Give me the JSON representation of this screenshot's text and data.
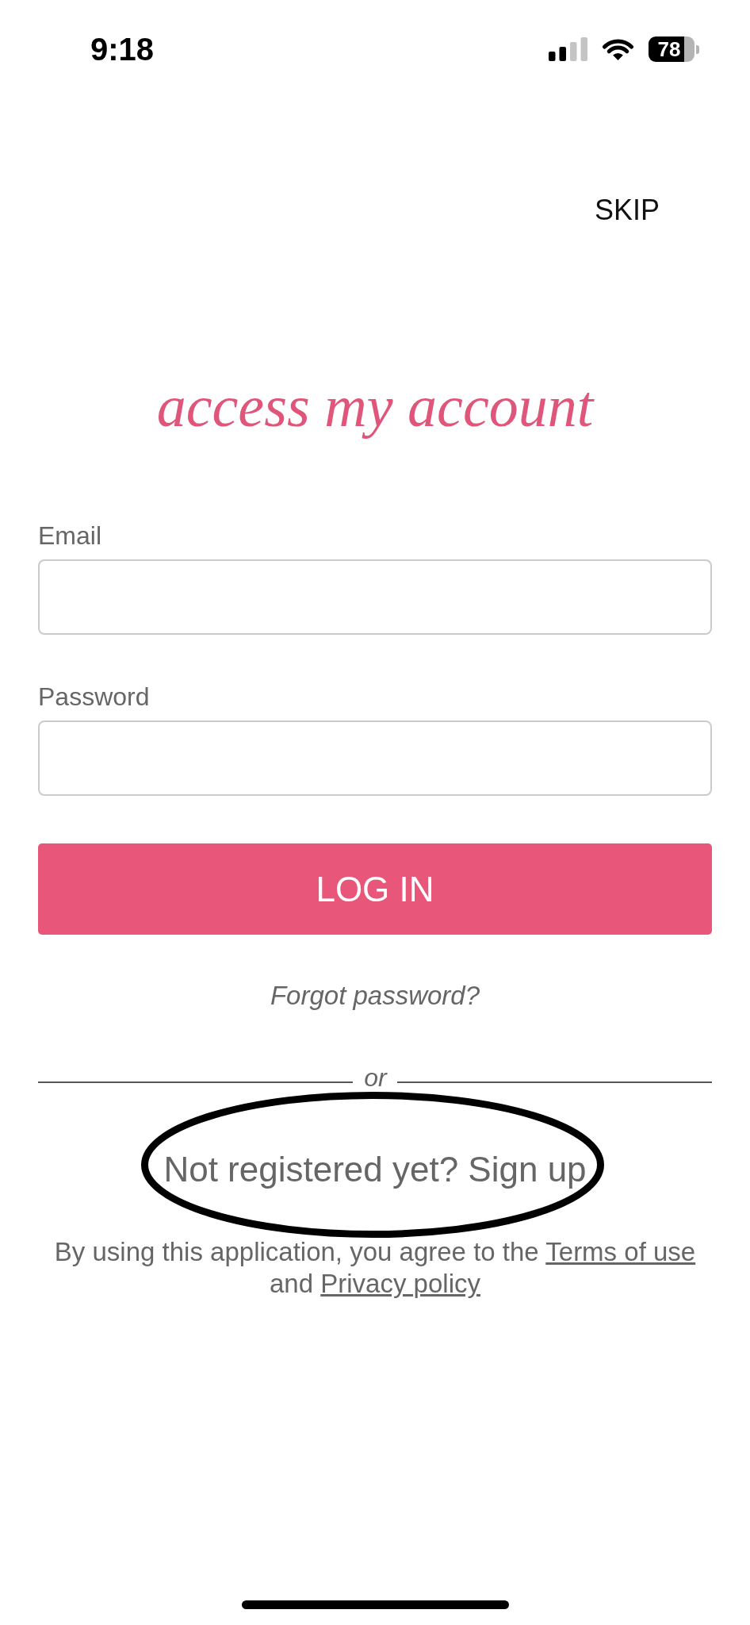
{
  "status_bar": {
    "time": "9:18",
    "battery": "78"
  },
  "skip_button": "SKIP",
  "title": "access my account",
  "fields": [
    {
      "label": "Email"
    },
    {
      "label": "Password"
    }
  ],
  "login_button": "LOG IN",
  "forgot_password": "Forgot password?",
  "divider": "or",
  "sign_up": {
    "text": "Not registered yet? Sign up",
    "circled": true
  },
  "legal": {
    "text": "By using this application, you agree to the",
    "terms_link": "Terms of use",
    "joiner": "and",
    "privacy_link": "Privacy policy"
  }
}
